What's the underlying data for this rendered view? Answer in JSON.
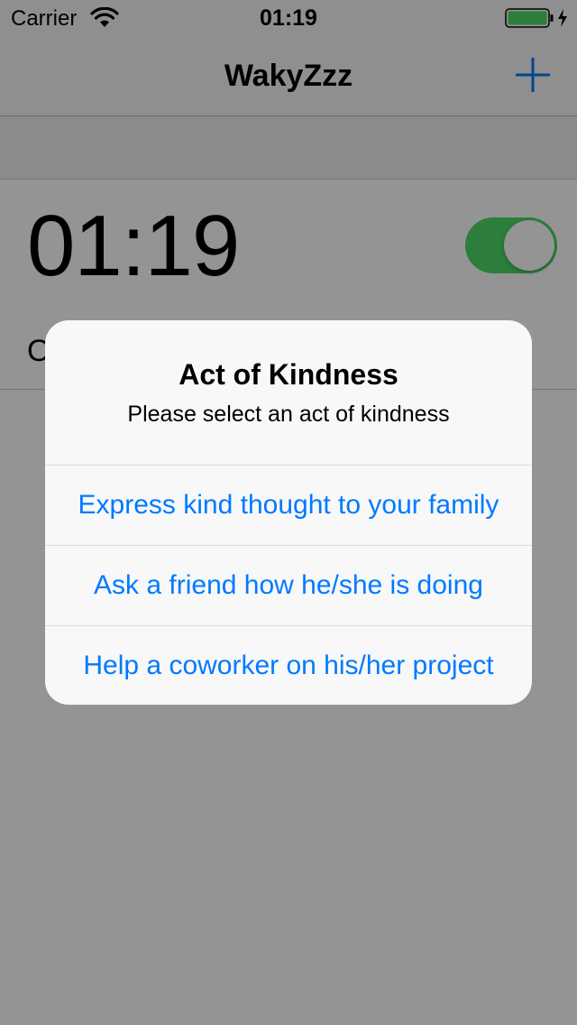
{
  "status_bar": {
    "carrier": "Carrier",
    "time": "01:19",
    "battery_color": "#4cd964",
    "icons": [
      "wifi-icon",
      "battery-icon",
      "charging-icon"
    ]
  },
  "nav_bar": {
    "title": "WakyZzz",
    "add_icon": "plus-icon"
  },
  "alarm": {
    "time": "01:19",
    "label": "O",
    "enabled": true,
    "toggle_color": "#4cd964"
  },
  "alert": {
    "title": "Act of Kindness",
    "message": "Please select an act of kindness",
    "actions": [
      {
        "label": "Express kind thought to your family"
      },
      {
        "label": "Ask a friend how he/she is doing"
      },
      {
        "label": "Help a coworker on his/her project"
      }
    ],
    "action_color": "#007aff"
  }
}
